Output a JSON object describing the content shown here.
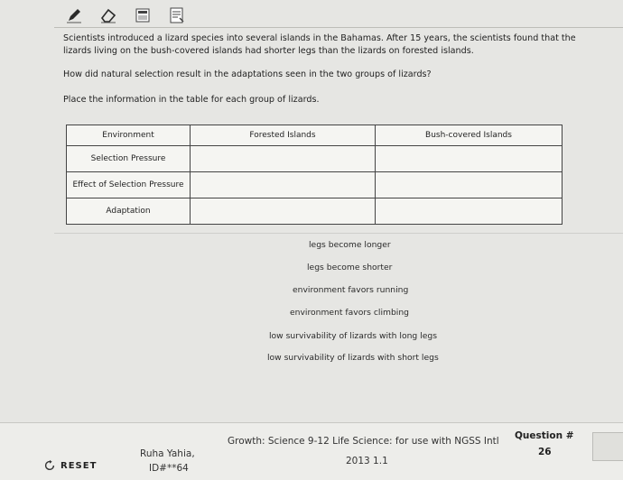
{
  "toolbar": {
    "tools": [
      {
        "name": "pencil-icon"
      },
      {
        "name": "eraser-icon"
      },
      {
        "name": "calculator-icon"
      },
      {
        "name": "notepad-icon"
      }
    ]
  },
  "prompt": {
    "paragraph1": "Scientists introduced a lizard species into several islands in the Bahamas. After 15 years, the scientists found that the lizards living on the bush-covered islands had shorter legs than the lizards on forested islands.",
    "question": "How did natural selection result in the adaptations seen in the two groups of lizards?",
    "instruction": "Place the information in the table for each group of lizards."
  },
  "table": {
    "headers": [
      "Environment",
      "Forested Islands",
      "Bush-covered Islands"
    ],
    "rows": [
      {
        "label": "Selection Pressure",
        "cells": [
          "",
          ""
        ]
      },
      {
        "label": "Effect of Selection Pressure",
        "cells": [
          "",
          ""
        ]
      },
      {
        "label": "Adaptation",
        "cells": [
          "",
          ""
        ]
      }
    ]
  },
  "bank": {
    "tiles": [
      "legs become longer",
      "legs become shorter",
      "environment favors running",
      "environment favors climbing",
      "low survivability of lizards with long legs",
      "low survivability of lizards with short legs"
    ]
  },
  "footer": {
    "reset": "RESET",
    "author": "Ruha Yahia,",
    "author_id": "ID#**64",
    "course": "Growth: Science 9-12 Life Science: for use with NGSS Intl",
    "course_year": "2013 1.1",
    "question_label": "Question #",
    "question_number": "26"
  }
}
